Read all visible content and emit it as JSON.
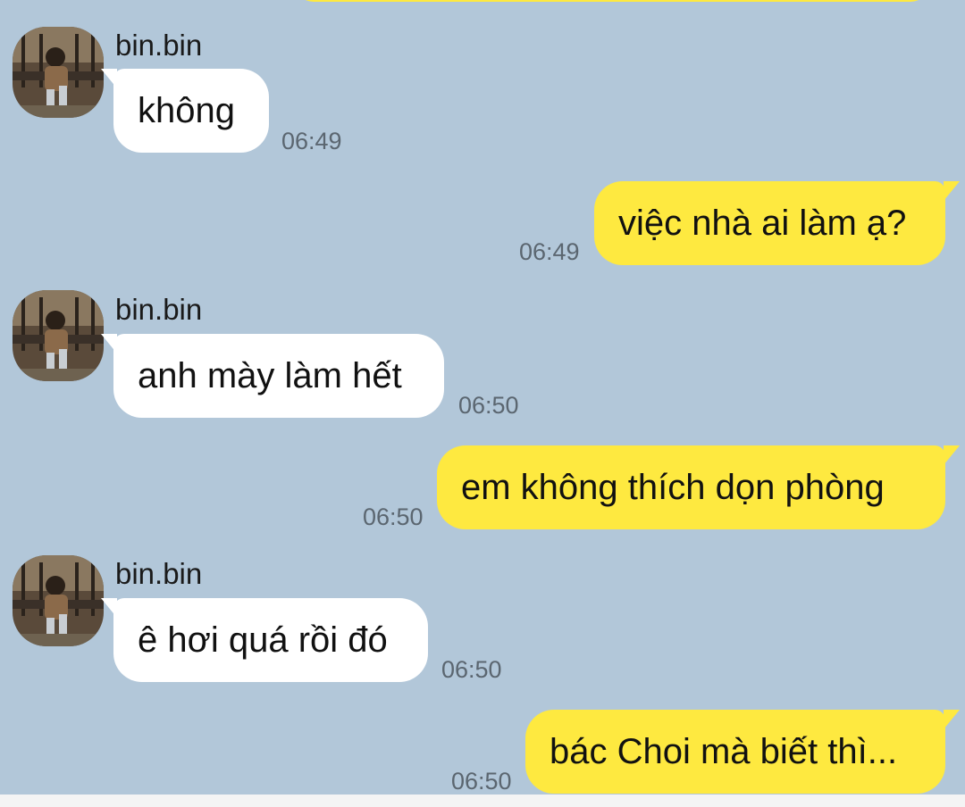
{
  "colors": {
    "background": "#b2c7d9",
    "incoming_bubble": "#ffffff",
    "outgoing_bubble": "#fee940",
    "timestamp": "#5b6670",
    "text": "#111111"
  },
  "contact": {
    "name": "bin.bin",
    "avatar_icon": "profile-photo-icon"
  },
  "messages": [
    {
      "direction": "incoming",
      "sender": "bin.bin",
      "text": "không",
      "time": "06:49"
    },
    {
      "direction": "outgoing",
      "text": "việc nhà ai làm ạ?",
      "time": "06:49"
    },
    {
      "direction": "incoming",
      "sender": "bin.bin",
      "text": "anh mày làm hết",
      "time": "06:50"
    },
    {
      "direction": "outgoing",
      "text": "em không thích dọn phòng",
      "time": "06:50"
    },
    {
      "direction": "incoming",
      "sender": "bin.bin",
      "text": "ê hơi quá rồi đó",
      "time": "06:50"
    },
    {
      "direction": "outgoing",
      "text": "bác Choi mà biết thì...",
      "time": "06:50"
    }
  ]
}
